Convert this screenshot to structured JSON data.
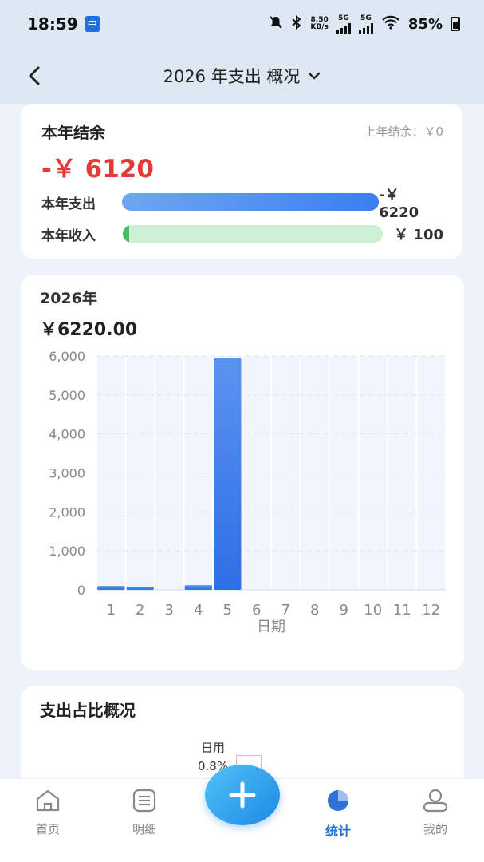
{
  "status": {
    "time": "18:59",
    "app_badge": "中",
    "net_speed_top": "8.50",
    "net_speed_bottom": "KB/s",
    "sim1": "5G",
    "sim2": "5G",
    "battery": "85%"
  },
  "header": {
    "title": "2026 年支出 概况"
  },
  "summary": {
    "title": "本年结余",
    "last_year": "上年结余：￥0",
    "balance": "-￥ 6120",
    "expense_label": "本年支出",
    "expense_value": "-￥ 6220",
    "income_label": "本年收入",
    "income_value": "￥ 100",
    "income_fraction": 0.016
  },
  "monthly": {
    "year": "2026年",
    "total": "￥6220.00"
  },
  "chart_data": {
    "type": "bar",
    "categories": [
      "1",
      "2",
      "3",
      "4",
      "5",
      "6",
      "7",
      "8",
      "9",
      "10",
      "11",
      "12"
    ],
    "values": [
      100,
      50,
      0,
      120,
      5950,
      0,
      0,
      0,
      0,
      0,
      0,
      0
    ],
    "xlabel": "日期",
    "ylabel": "",
    "ylim": [
      0,
      6000
    ],
    "yticks": [
      "0",
      "1,000",
      "2,000",
      "3,000",
      "4,000",
      "5,000",
      "6,000"
    ],
    "ytick_values": [
      0,
      1000,
      2000,
      3000,
      4000,
      5000,
      6000
    ],
    "grid": true,
    "colors": {
      "bar_top": "#5b93ef",
      "bar_bottom": "#2f6fe6"
    }
  },
  "ratio": {
    "title": "支出占比概况",
    "label_name": "日用",
    "label_pct": "0.8%"
  },
  "tabs": {
    "home": "首页",
    "detail": "明细",
    "stats": "统计",
    "mine": "我的"
  },
  "colors": {
    "accent": "#2f6fd8",
    "negative": "#e53935",
    "income": "#3ec063"
  }
}
